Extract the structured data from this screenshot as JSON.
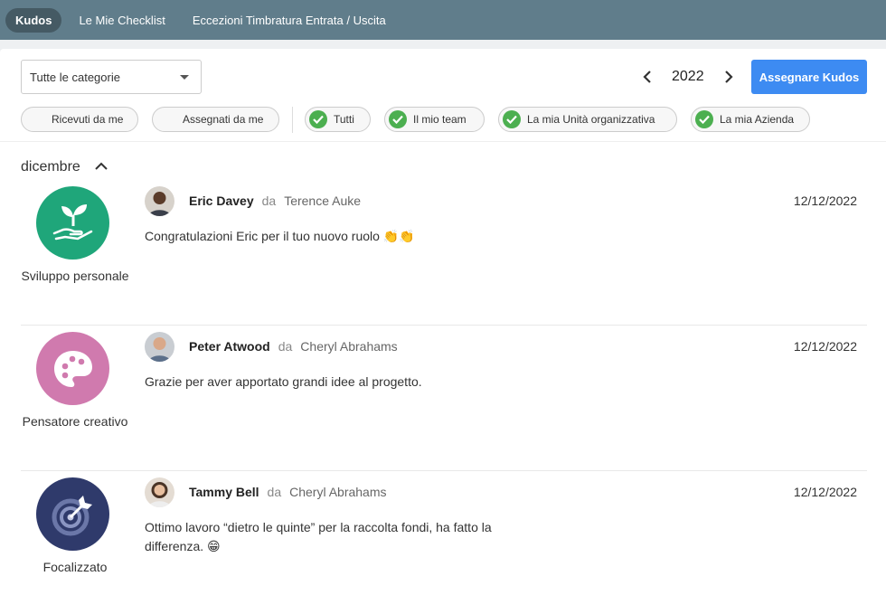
{
  "nav": {
    "tabs": [
      {
        "label": "Kudos",
        "active": true
      },
      {
        "label": "Le Mie Checklist",
        "active": false
      },
      {
        "label": "Eccezioni Timbratura Entrata / Uscita",
        "active": false
      }
    ]
  },
  "filters": {
    "category_select": "Tutte le categorie",
    "year": "2022",
    "assign_button": "Assegnare Kudos",
    "chips": [
      {
        "label": "Ricevuti da me",
        "checked": false
      },
      {
        "label": "Assegnati da me",
        "checked": false
      },
      {
        "label": "Tutti",
        "checked": true
      },
      {
        "label": "Il mio team",
        "checked": true
      },
      {
        "label": "La mia Unità organizzativa",
        "checked": true
      },
      {
        "label": "La mia Azienda",
        "checked": true
      }
    ]
  },
  "colors": {
    "accent": "#3d8bf2",
    "check": "#4caf50",
    "nav_bg": "#607d8b",
    "badge_growth": "#1fa67a",
    "badge_creative": "#d07aae",
    "badge_focused": "#2f3a6b"
  },
  "month": {
    "label": "dicembre"
  },
  "kudos": [
    {
      "category": "Sviluppo personale",
      "badge_icon": "plant-hand-icon",
      "recipient": "Eric Davey",
      "da": "da",
      "giver": "Terence Auke",
      "date": "12/12/2022",
      "message": "Congratulazioni Eric per il tuo nuovo ruolo 👏👏"
    },
    {
      "category": "Pensatore creativo",
      "badge_icon": "palette-icon",
      "recipient": "Peter Atwood",
      "da": "da",
      "giver": "Cheryl Abrahams",
      "date": "12/12/2022",
      "message": "Grazie per aver apportato grandi idee al progetto."
    },
    {
      "category": "Focalizzato",
      "badge_icon": "target-icon",
      "recipient": "Tammy Bell",
      "da": "da",
      "giver": "Cheryl Abrahams",
      "date": "12/12/2022",
      "message": "Ottimo lavoro “dietro le quinte” per la raccolta fondi, ha fatto la differenza. 😁"
    }
  ]
}
